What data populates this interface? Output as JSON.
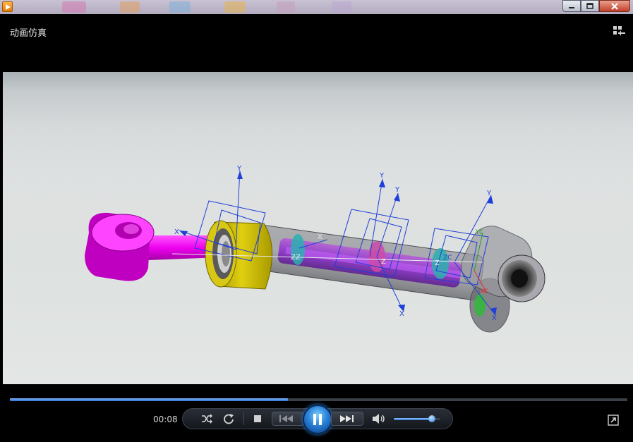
{
  "window": {
    "title": "动画仿真",
    "buttons": {
      "minimize": "minimize-icon",
      "maximize": "maximize-icon",
      "close": "close-icon"
    }
  },
  "scene": {
    "axis_labels": {
      "y": "Y",
      "x": "X",
      "z": "Z",
      "zz": "ZZ",
      "zc": "ZC",
      "yc": "YC",
      "xc": "XC"
    }
  },
  "playback": {
    "time": "00:08",
    "progress": 0.45,
    "volume": 0.82,
    "state": "playing"
  },
  "colors": {
    "progress_fill": "#2f6fd0",
    "rod_end": "#ff00ff",
    "collar": "#d4c300",
    "axis": "#1f3fd8"
  }
}
